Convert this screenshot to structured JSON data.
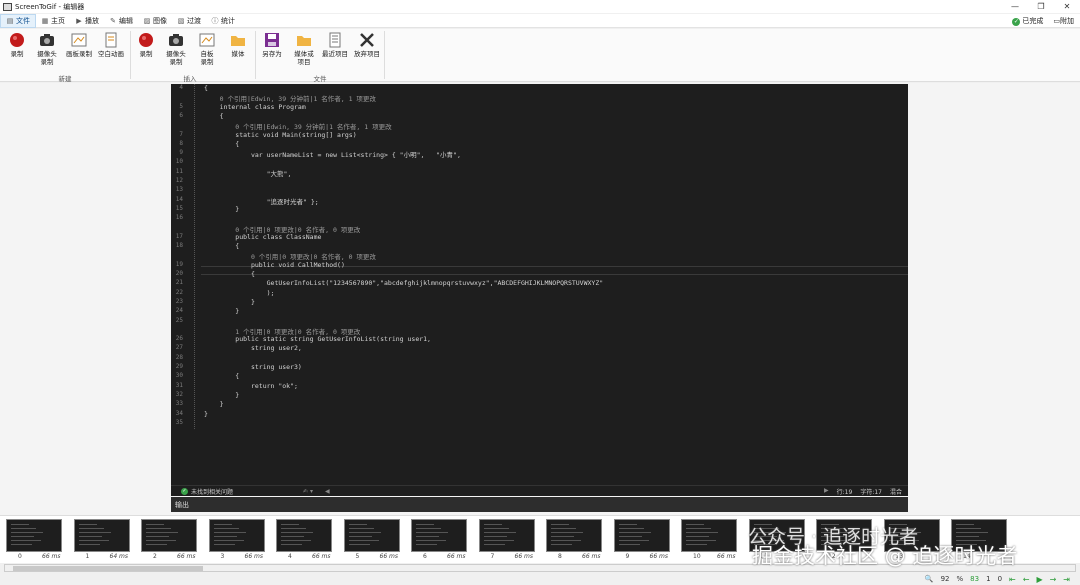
{
  "window": {
    "title": "ScreenToGif - 编辑器",
    "minimize": "—",
    "restore": "❐",
    "close": "✕"
  },
  "tabs": [
    {
      "label": "文件",
      "icon": "file-icon",
      "active": true
    },
    {
      "label": "主页",
      "icon": "home-icon"
    },
    {
      "label": "播放",
      "icon": "play-icon"
    },
    {
      "label": "编辑",
      "icon": "edit-icon"
    },
    {
      "label": "图像",
      "icon": "image-icon"
    },
    {
      "label": "过渡",
      "icon": "transition-icon"
    },
    {
      "label": "统计",
      "icon": "info-icon"
    }
  ],
  "tabs_right": {
    "status": "已完成",
    "extra": "附加"
  },
  "ribbon": {
    "new": {
      "group": "新建",
      "buttons": [
        "录制",
        "摄像头\n录制",
        "画板录制",
        "空白动画"
      ]
    },
    "insert": {
      "group": "插入",
      "buttons": [
        "录制",
        "摄像头\n录制",
        "自板\n录制",
        "媒体"
      ]
    },
    "file": {
      "group": "文件",
      "buttons": [
        "另存为",
        "媒体或\n项目",
        "最近项目",
        "放弃项目"
      ]
    }
  },
  "code": {
    "lines": [
      {
        "n": "4",
        "t": "{"
      },
      {
        "n": "",
        "t": "    0 个引用|Edwin, 39 分钟前|1 名作者, 1 项更改",
        "c": "cm"
      },
      {
        "n": "5",
        "t": "    internal class Program"
      },
      {
        "n": "6",
        "t": "    {"
      },
      {
        "n": "",
        "t": "        0 个引用|Edwin, 39 分钟前|1 名作者, 1 项更改",
        "c": "cm"
      },
      {
        "n": "7",
        "t": "        static void Main(string[] args)"
      },
      {
        "n": "8",
        "t": "        {"
      },
      {
        "n": "9",
        "t": "            var userNameList = new List<string> { \"小明\",   \"小青\","
      },
      {
        "n": "10",
        "t": ""
      },
      {
        "n": "11",
        "t": "                \"大熊\","
      },
      {
        "n": "12",
        "t": ""
      },
      {
        "n": "13",
        "t": ""
      },
      {
        "n": "14",
        "t": "                \"追逐时光者\" };"
      },
      {
        "n": "15",
        "t": "        }"
      },
      {
        "n": "16",
        "t": ""
      },
      {
        "n": "",
        "t": "        0 个引用|0 项更改|0 名作者, 0 项更改",
        "c": "cm"
      },
      {
        "n": "17",
        "t": "        public class ClassName"
      },
      {
        "n": "18",
        "t": "        {"
      },
      {
        "n": "",
        "t": "            0 个引用|0 项更改|0 名作者, 0 项更改",
        "c": "cm"
      },
      {
        "n": "19",
        "t": "            public void CallMethod()"
      },
      {
        "n": "20",
        "t": "            {"
      },
      {
        "n": "21",
        "t": "                GetUserInfoList(\"1234567890\",\"abcdefghijklmnopqrstuvwxyz\",\"ABCDEFGHIJKLMNOPQRSTUVWXYZ\""
      },
      {
        "n": "22",
        "t": "                );"
      },
      {
        "n": "23",
        "t": "            }"
      },
      {
        "n": "24",
        "t": "        }"
      },
      {
        "n": "25",
        "t": ""
      },
      {
        "n": "",
        "t": "        1 个引用|0 项更改|0 名作者, 0 项更改",
        "c": "cm"
      },
      {
        "n": "26",
        "t": "        public static string GetUserInfoList(string user1,"
      },
      {
        "n": "27",
        "t": "            string user2,"
      },
      {
        "n": "28",
        "t": ""
      },
      {
        "n": "29",
        "t": "            string user3)"
      },
      {
        "n": "30",
        "t": "        {"
      },
      {
        "n": "31",
        "t": "            return \"ok\";"
      },
      {
        "n": "32",
        "t": "        }"
      },
      {
        "n": "33",
        "t": "    }"
      },
      {
        "n": "34",
        "t": "}"
      },
      {
        "n": "35",
        "t": ""
      }
    ]
  },
  "editor_status": {
    "msg": "未找到相关问题",
    "ln": "行:19",
    "ch": "字符:17",
    "mode": "混合"
  },
  "output_label": "输出",
  "frames": [
    {
      "i": "0",
      "ms": "66 ms"
    },
    {
      "i": "1",
      "ms": "64 ms"
    },
    {
      "i": "2",
      "ms": "66 ms"
    },
    {
      "i": "3",
      "ms": "66 ms"
    },
    {
      "i": "4",
      "ms": "66 ms"
    },
    {
      "i": "5",
      "ms": "66 ms"
    },
    {
      "i": "6",
      "ms": "66 ms"
    },
    {
      "i": "7",
      "ms": "66 ms"
    },
    {
      "i": "8",
      "ms": "66 ms"
    },
    {
      "i": "9",
      "ms": "66 ms"
    },
    {
      "i": "10",
      "ms": "66 ms"
    },
    {
      "i": "11",
      "ms": ""
    },
    {
      "i": "12",
      "ms": ""
    },
    {
      "i": "13",
      "ms": ""
    },
    {
      "i": "14",
      "ms": ""
    }
  ],
  "statusbar": {
    "zoom": "92",
    "pct": "%",
    "count1": "83",
    "count2": "1",
    "count3": "0"
  },
  "watermark": {
    "line1": "公众号 · 追逐时光者",
    "line2": "掘金技术社区 @ 追逐时光者"
  }
}
